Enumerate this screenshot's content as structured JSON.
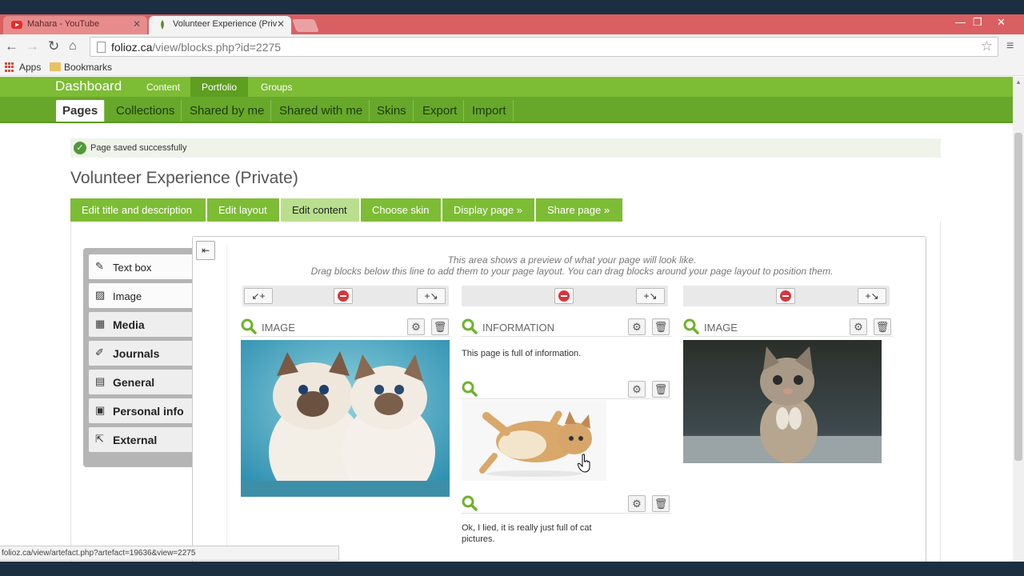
{
  "browser": {
    "tabs": [
      {
        "title": "Mahara - YouTube",
        "active": false
      },
      {
        "title": "Volunteer Experience (Priv",
        "active": true
      }
    ],
    "url_domain": "folioz.ca",
    "url_path": "/view/blocks.php?id=2275",
    "bookmarks": {
      "apps": "Apps",
      "folder": "Bookmarks"
    },
    "status_url": "folioz.ca/view/artefact.php?artefact=19636&view=2275"
  },
  "mainnav": {
    "brand": "Dashboard",
    "items": [
      "Content",
      "Portfolio",
      "Groups"
    ],
    "selected": "Portfolio"
  },
  "subnav": {
    "items": [
      "Pages",
      "Collections",
      "Shared by me",
      "Shared with me",
      "Skins",
      "Export",
      "Import"
    ],
    "selected": "Pages"
  },
  "message": "Page saved successfully",
  "page_title": "Volunteer Experience (Private)",
  "edit_tabs": [
    "Edit title and description",
    "Edit layout",
    "Edit content",
    "Choose skin",
    "Display page »",
    "Share page »"
  ],
  "edit_tab_selected": "Edit content",
  "palette": [
    {
      "label": "Text box",
      "icon": "text-box-icon"
    },
    {
      "label": "Image",
      "icon": "image-icon"
    },
    {
      "label": "Media",
      "icon": "media-icon"
    },
    {
      "label": "Journals",
      "icon": "journal-pen-icon"
    },
    {
      "label": "General",
      "icon": "general-icon"
    },
    {
      "label": "Personal info",
      "icon": "personal-info-icon"
    },
    {
      "label": "External",
      "icon": "external-icon"
    }
  ],
  "hint": {
    "line1": "This area shows a preview of what your page will look like.",
    "line2": "Drag blocks below this line to add them to your page layout. You can drag blocks around your page layout to position them."
  },
  "blocks": {
    "col1_image_title": "IMAGE",
    "col2_info_title": "INFORMATION",
    "col2_info_text": "This page is full of information.",
    "col2_bottom_text": "Ok, I lied, it is really just full of cat pictures.",
    "col3_image_title": "IMAGE"
  },
  "colors": {
    "accent_green": "#7dbc35",
    "dark_green": "#67a82b",
    "tab_red": "#d95f62"
  }
}
